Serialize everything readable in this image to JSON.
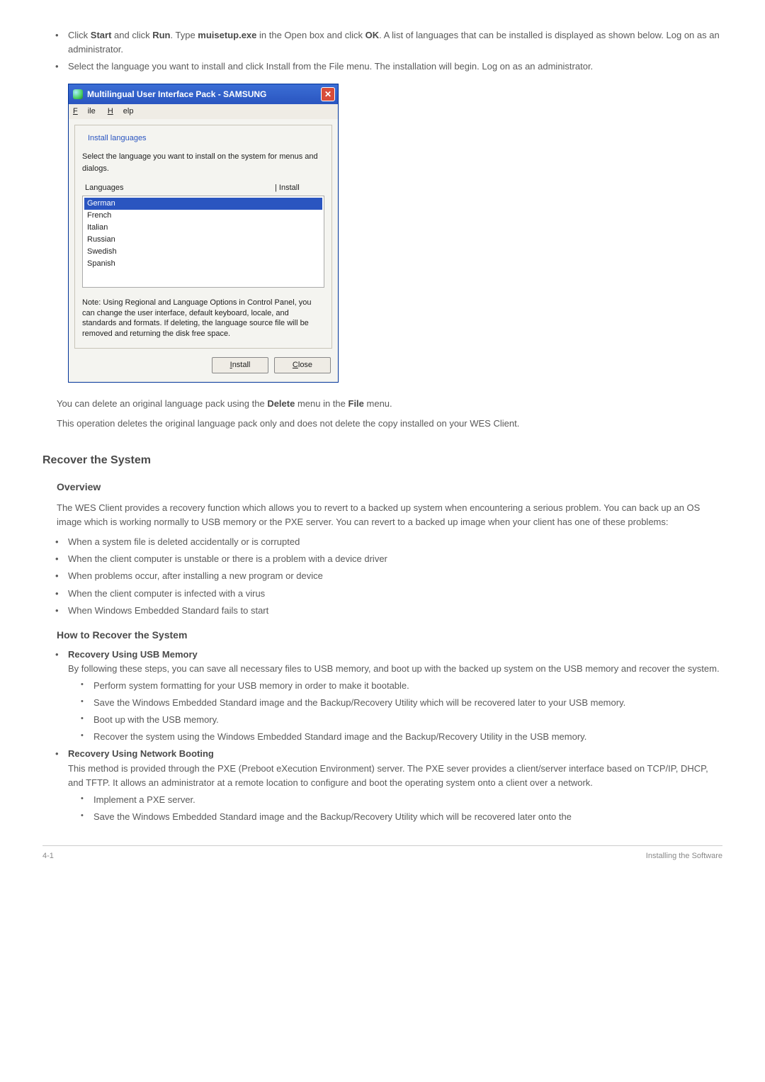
{
  "intro_bullets": [
    {
      "pre": "Click ",
      "b1": "Start",
      "mid1": " and click ",
      "b2": "Run",
      "mid2": ". Type ",
      "b3": "muisetup.exe",
      "mid3": " in the Open box and click ",
      "b4": "OK",
      "post": ". A list of languages that can be installed is displayed as shown below. Log on as an administrator."
    },
    {
      "text": "Select the language you want to install and click Install from the File menu. The installation will begin. Log on as an administrator."
    }
  ],
  "dialog": {
    "title": "Multilingual User Interface Pack - SAMSUNG",
    "menu": {
      "file": "File",
      "help": "Help"
    },
    "group_label": "Install languages",
    "instruction": "Select the language you want to install on the system for menus and dialogs.",
    "col_lang": "Languages",
    "col_install": "Install",
    "items": [
      "German",
      "French",
      "Italian",
      "Russian",
      "Swedish",
      "Spanish"
    ],
    "note": "Note: Using Regional and Language Options in Control Panel, you can change the user interface, default keyboard, locale, and standards and formats. If deleting, the language source file will be removed and returning the disk free space.",
    "btn_install": "Install",
    "btn_close": "Close"
  },
  "after_dialog": {
    "p1_pre": "You can delete an original language pack using the ",
    "p1_b1": "Delete",
    "p1_mid": " menu in the ",
    "p1_b2": "File",
    "p1_post": " menu.",
    "p2": "This operation deletes the original language pack only and does not delete the copy installed on your WES Client."
  },
  "recover": {
    "h2": "Recover the System",
    "overview_h": "Overview",
    "overview_p": "The WES Client provides a recovery function which allows you to revert to a backed up system when encountering a serious problem. You can back up an OS image which is working normally to USB memory or the PXE server. You can revert to a backed up image when your client has one of these problems:",
    "overview_list": [
      "When a system file is deleted accidentally or is corrupted",
      "When the client computer is unstable or there is a problem with a device driver",
      "When problems occur, after installing a new program or device",
      "When the client computer is infected with a virus",
      "When Windows Embedded Standard fails to start"
    ],
    "how_h": "How to Recover the System",
    "usb": {
      "title": "Recovery Using USB Memory",
      "intro": "By following these steps, you can save all necessary files to USB memory, and boot up with the backed up system on the USB memory and recover the system.",
      "steps": [
        "Perform system formatting for your USB memory in order to make it bootable.",
        "Save the Windows Embedded Standard image and the Backup/Recovery Utility which will be recovered later to your USB memory.",
        "Boot up with the USB memory.",
        "Recover the system using the Windows Embedded Standard image and the Backup/Recovery Utility in the USB memory."
      ]
    },
    "net": {
      "title": "Recovery Using Network Booting",
      "intro": "This method is provided through the PXE (Preboot eXecution Environment) server. The PXE sever provides a client/server interface based on TCP/IP, DHCP, and TFTP. It allows an administrator at a remote location to configure and boot the operating system onto a client over a network.",
      "steps": [
        "Implement a PXE server.",
        "Save the Windows Embedded Standard image and the Backup/Recovery Utility which will be recovered later onto the"
      ]
    }
  },
  "footer": {
    "left": "4-1",
    "right": "Installing the Software"
  }
}
